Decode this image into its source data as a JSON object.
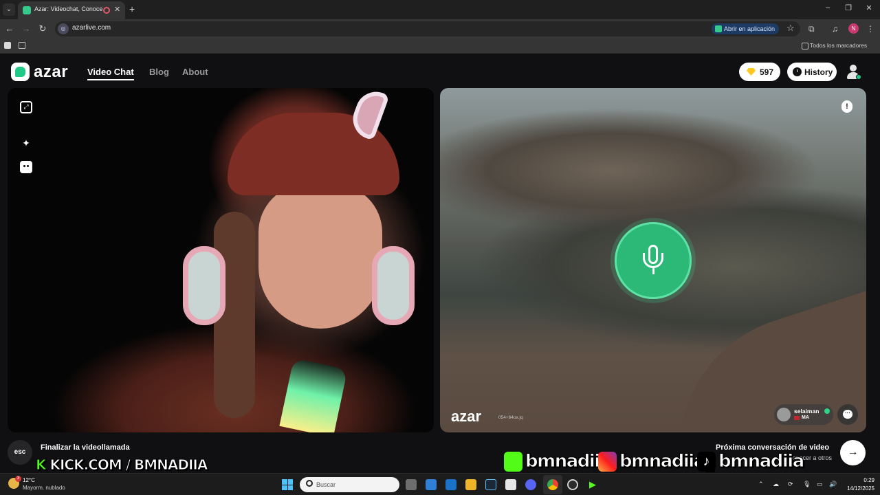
{
  "browser": {
    "tab_title": "Azar: Videochat, Conoce Ac",
    "tab_close": "✕",
    "new_tab": "+",
    "url": "azarlive.com",
    "open_in_app": "Abrir en aplicación",
    "profile_initial": "N",
    "all_bookmarks": "Todos los marcadores"
  },
  "site": {
    "logo_text": "azar",
    "nav": [
      {
        "label": "Video Chat",
        "active": true
      },
      {
        "label": "Blog",
        "active": false
      },
      {
        "label": "About",
        "active": false
      }
    ],
    "gems": "597",
    "history_label": "History"
  },
  "remote": {
    "watermark_logo": "azar",
    "watermark_code": "054+64ox.jq",
    "peer_name": "selaiman",
    "peer_country": "MA"
  },
  "bottom": {
    "esc_key": "esc",
    "end_call_label": "Finalizar la videollamada",
    "next_label": "Próxima conversación de video",
    "next_sub": "conocer a otros",
    "next_arrow": "→"
  },
  "stream_overlay": {
    "kick_k": "K",
    "kick_text": "KICK.COM / BMNADIIA",
    "kick_handle": "bmnadiia",
    "instagram_handle": "bmnadiia_",
    "tiktok_handle": "bmnadiia"
  },
  "taskbar": {
    "weather_badge": "3",
    "temperature": "12°C",
    "condition": "Mayorm. nublado",
    "search_placeholder": "Buscar",
    "time": "0:29",
    "date": "14/12/2025"
  },
  "colors": {
    "brand_green": "#20c987",
    "mic_green": "#2cb877",
    "kick_green": "#53fc18",
    "gem_yellow": "#ffc81e"
  },
  "icons": [
    "expand-icon",
    "sparkle-icon",
    "face-filter-icon",
    "report-icon",
    "microphone-icon",
    "chat-icon",
    "gem-icon",
    "history-clock-icon",
    "user-icon"
  ]
}
